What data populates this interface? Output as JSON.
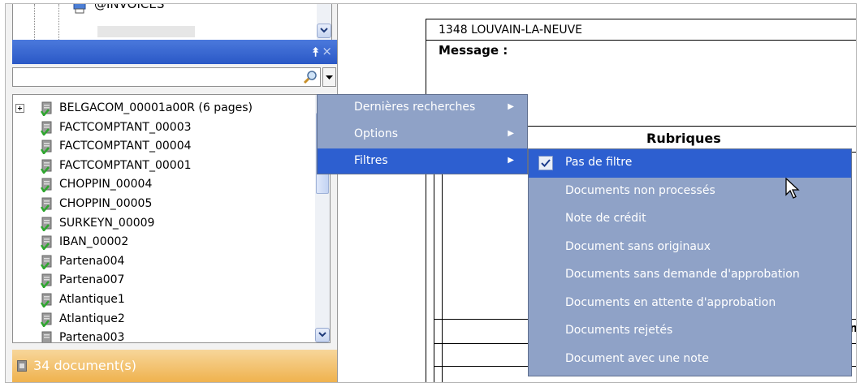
{
  "left_panel": {
    "top_tree_label": "@INVOICES",
    "search": {
      "value": "",
      "placeholder": ""
    },
    "documents": [
      "BELGACOM_00001a00R (6 pages)",
      "FACTCOMPTANT_00003",
      "FACTCOMPTANT_00004",
      "FACTCOMPTANT_00001",
      "CHOPPIN_00004",
      "CHOPPIN_00005",
      "SURKEYN_00009",
      "IBAN_00002",
      "Partena004",
      "Partena007",
      "Atlantique1",
      "Atlantique2",
      "Partena003"
    ],
    "status_text": "34 document(s)"
  },
  "document": {
    "address": "1348 LOUVAIN-LA-NEUVE",
    "message_label": "Message :",
    "rubriques_header": "Rubriques",
    "cut_text": "ne"
  },
  "context_menu": {
    "items": [
      {
        "label": "Dernières recherches"
      },
      {
        "label": "Options"
      },
      {
        "label": "Filtres"
      }
    ]
  },
  "filter_submenu": {
    "items": [
      {
        "label": "Pas de filtre",
        "checked": true
      },
      {
        "label": "Documents non processés"
      },
      {
        "label": "Note de crédit"
      },
      {
        "label": "Document sans originaux"
      },
      {
        "label": "Documents sans demande d'approbation"
      },
      {
        "label": "Documents en attente d'approbation"
      },
      {
        "label": "Documents rejetés"
      },
      {
        "label": "Document avec une note"
      }
    ]
  },
  "colors": {
    "title_bar": "#2a58c6",
    "menu_bg": "#8fa2c7",
    "menu_highlight": "#2d5fd0",
    "status_bar": "#efb24e"
  },
  "icons": [
    "folder-icon",
    "chevron-down-icon",
    "collapse-icon",
    "close-icon",
    "search-icon",
    "expand-plus-icon",
    "document-icon",
    "submenu-arrow-icon",
    "checkmark-icon",
    "mouse-cursor-icon"
  ]
}
